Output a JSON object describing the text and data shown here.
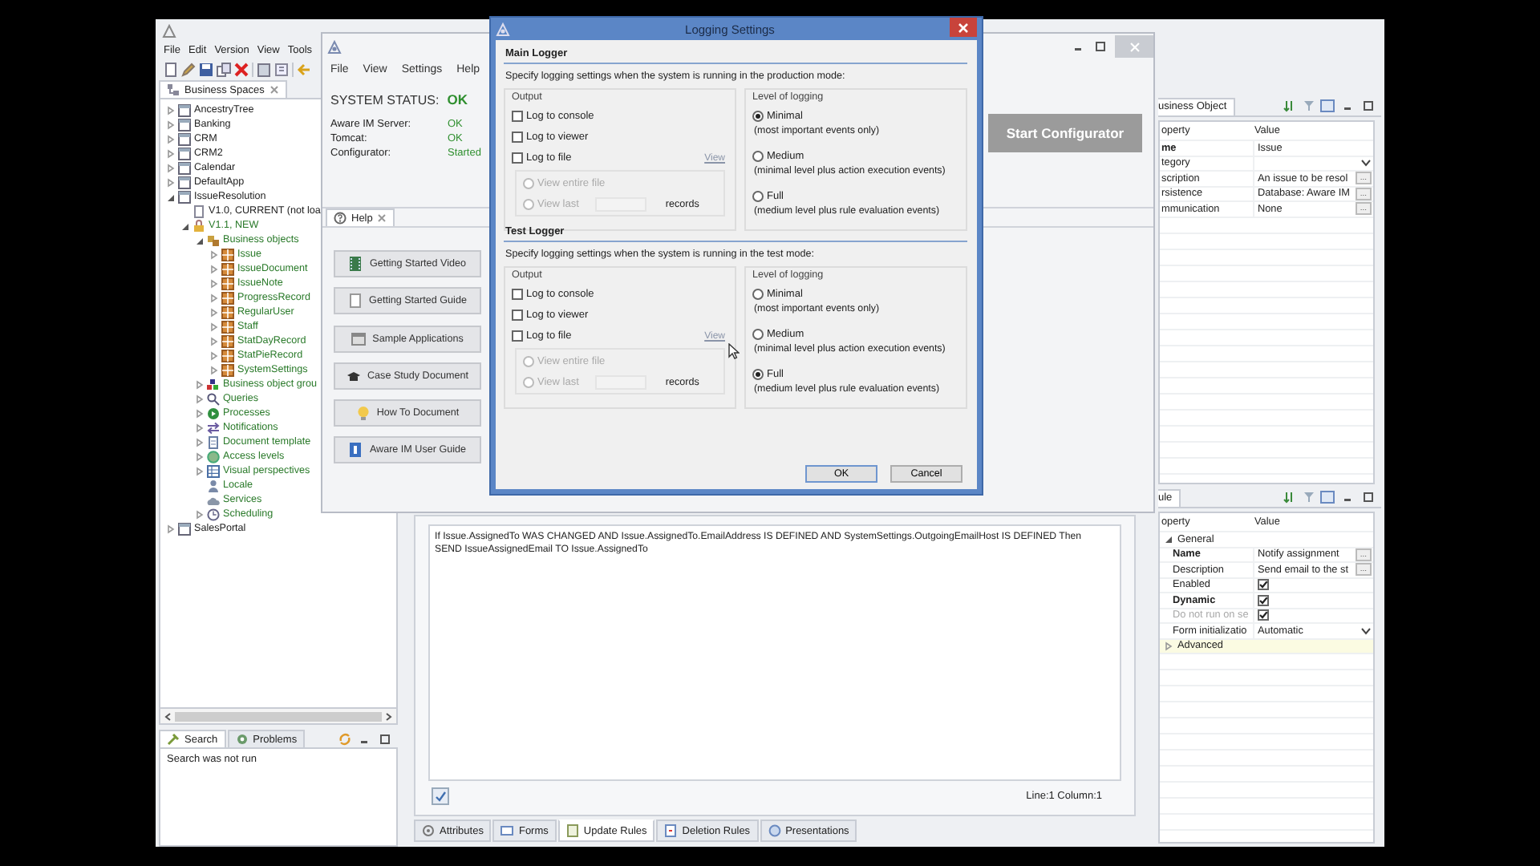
{
  "ide": {
    "menu": [
      "File",
      "Edit",
      "Version",
      "View",
      "Tools"
    ],
    "spaces_panel": {
      "tab": "Business Spaces",
      "tree": [
        {
          "label": "AncestryTree",
          "kind": "space",
          "expanded": false,
          "color": "#222222"
        },
        {
          "label": "Banking",
          "kind": "space",
          "expanded": false,
          "color": "#222222"
        },
        {
          "label": "CRM",
          "kind": "space",
          "expanded": false,
          "color": "#222222"
        },
        {
          "label": "CRM2",
          "kind": "space",
          "expanded": false,
          "color": "#222222"
        },
        {
          "label": "Calendar",
          "kind": "space",
          "expanded": false,
          "color": "#222222"
        },
        {
          "label": "DefaultApp",
          "kind": "space",
          "expanded": false,
          "color": "#222222"
        },
        {
          "label": "IssueResolution",
          "kind": "space",
          "expanded": true,
          "color": "#222222",
          "children": [
            {
              "label": "V1.0, CURRENT (not loa",
              "kind": "version",
              "color": "#222222"
            },
            {
              "label": "V1.1, NEW",
              "kind": "lock",
              "expanded": true,
              "color": "#2a7a2a",
              "children": [
                {
                  "label": "Business objects",
                  "kind": "objects",
                  "expanded": true,
                  "color": "#2a7a2a",
                  "children": [
                    {
                      "label": "Issue",
                      "kind": "object",
                      "expanded": false,
                      "color": "#2a7a2a"
                    },
                    {
                      "label": "IssueDocument",
                      "kind": "object",
                      "expanded": false,
                      "color": "#2a7a2a"
                    },
                    {
                      "label": "IssueNote",
                      "kind": "object",
                      "expanded": false,
                      "color": "#2a7a2a"
                    },
                    {
                      "label": "ProgressRecord",
                      "kind": "object",
                      "expanded": false,
                      "color": "#2a7a2a"
                    },
                    {
                      "label": "RegularUser",
                      "kind": "object",
                      "expanded": false,
                      "color": "#2a7a2a"
                    },
                    {
                      "label": "Staff",
                      "kind": "object",
                      "expanded": false,
                      "color": "#2a7a2a"
                    },
                    {
                      "label": "StatDayRecord",
                      "kind": "object",
                      "expanded": false,
                      "color": "#2a7a2a"
                    },
                    {
                      "label": "StatPieRecord",
                      "kind": "object",
                      "expanded": false,
                      "color": "#2a7a2a"
                    },
                    {
                      "label": "SystemSettings",
                      "kind": "object",
                      "expanded": false,
                      "color": "#2a7a2a"
                    }
                  ]
                },
                {
                  "label": "Business object grou",
                  "kind": "groups",
                  "expanded": false,
                  "color": "#2a7a2a"
                },
                {
                  "label": "Queries",
                  "kind": "query",
                  "expanded": false,
                  "color": "#2a7a2a"
                },
                {
                  "label": "Processes",
                  "kind": "process",
                  "expanded": false,
                  "color": "#2a7a2a"
                },
                {
                  "label": "Notifications",
                  "kind": "notification",
                  "expanded": false,
                  "color": "#2a7a2a"
                },
                {
                  "label": "Document template",
                  "kind": "document",
                  "expanded": false,
                  "color": "#2a7a2a"
                },
                {
                  "label": "Access levels",
                  "kind": "access",
                  "expanded": false,
                  "color": "#2a7a2a"
                },
                {
                  "label": "Visual perspectives",
                  "kind": "perspective",
                  "expanded": false,
                  "color": "#2a7a2a"
                },
                {
                  "label": "Locale",
                  "kind": "locale",
                  "color": "#2a7a2a"
                },
                {
                  "label": "Services",
                  "kind": "services",
                  "color": "#2a7a2a"
                },
                {
                  "label": "Scheduling",
                  "kind": "scheduling",
                  "expanded": false,
                  "color": "#2a7a2a"
                }
              ]
            }
          ]
        },
        {
          "label": "SalesPortal",
          "kind": "space",
          "expanded": false,
          "color": "#222222"
        }
      ]
    },
    "search_panel": {
      "tabs": [
        {
          "label": "Search",
          "selected": true
        },
        {
          "label": "Problems",
          "selected": false
        }
      ],
      "message": "Search was not run"
    },
    "rule_lines": [
      "If Issue.AssignedTo WAS CHANGED  AND Issue.AssignedTo.EmailAddress IS DEFINED AND SystemSettings.OutgoingEmailHost IS DEFINED Then",
      "SEND IssueAssignedEmail TO Issue.AssignedTo"
    ],
    "position": "Line:1 Column:1",
    "editor_tabs": [
      {
        "label": "Attributes",
        "selected": false
      },
      {
        "label": "Forms",
        "selected": false
      },
      {
        "label": "Update Rules",
        "selected": true
      },
      {
        "label": "Deletion Rules",
        "selected": false
      },
      {
        "label": "Presentations",
        "selected": false
      }
    ],
    "object_panel": {
      "tab": "usiness Object",
      "columns": [
        "operty",
        "Value"
      ],
      "rows": [
        {
          "property": "me",
          "bold": true,
          "kind": "text",
          "value": "Issue"
        },
        {
          "property": "tegory",
          "bold": false,
          "kind": "dropdown"
        },
        {
          "property": "scription",
          "bold": false,
          "kind": "text",
          "value": "An issue to be resol",
          "button": "..."
        },
        {
          "property": "rsistence",
          "bold": false,
          "kind": "text",
          "value": "Database: Aware IM",
          "button": "..."
        },
        {
          "property": "mmunication",
          "bold": false,
          "kind": "text",
          "value": "None",
          "button": "..."
        }
      ]
    },
    "rule_panel": {
      "tab": "ule",
      "columns": [
        "operty",
        "Value"
      ],
      "groups": [
        {
          "label": "General",
          "expanded": true,
          "selected": false,
          "rows": [
            {
              "property": "Name",
              "bold": true,
              "disabled": false,
              "kind": "text",
              "value": "Notify assignment",
              "button": "..."
            },
            {
              "property": "Description",
              "bold": false,
              "disabled": false,
              "kind": "text",
              "value": "Send email to the st",
              "button": "..."
            },
            {
              "property": "Enabled",
              "bold": false,
              "disabled": false,
              "kind": "checkbox",
              "checked": true
            },
            {
              "property": "Dynamic",
              "bold": true,
              "disabled": false,
              "kind": "checkbox",
              "checked": true
            },
            {
              "property": "Do not run on se",
              "bold": false,
              "disabled": true,
              "kind": "checkbox",
              "checked": true
            },
            {
              "property": "Form initializatio",
              "bold": false,
              "disabled": false,
              "kind": "dropdown",
              "value": "Automatic"
            }
          ]
        },
        {
          "label": "Advanced",
          "expanded": false,
          "selected": true
        }
      ]
    }
  },
  "control": {
    "menu": [
      "File",
      "View",
      "Settings",
      "Help"
    ],
    "status": {
      "label": "SYSTEM STATUS:",
      "value": "OK"
    },
    "services": [
      {
        "name": "Aware IM Server:",
        "status": "OK"
      },
      {
        "name": "Tomcat:",
        "status": "OK"
      },
      {
        "name": "Configurator:",
        "status": "Started"
      }
    ],
    "start_button": "Start Configurator",
    "help_tab": "Help",
    "help_buttons": [
      {
        "label": "Getting Started Video",
        "kind": "video"
      },
      {
        "label": "Getting Started Guide",
        "kind": "guide"
      },
      {
        "label": "Sample Applications",
        "kind": "samples"
      },
      {
        "label": "Case Study Document",
        "kind": "study"
      },
      {
        "label": "How To Document",
        "kind": "howto"
      },
      {
        "label": "Aware IM User Guide",
        "kind": "book"
      }
    ]
  },
  "dialog": {
    "title": "Logging Settings",
    "loggers": [
      {
        "title": "Main Logger",
        "description": "Specify logging settings when the system is running in the production mode:",
        "output": {
          "label": "Output",
          "options": [
            {
              "label": "Log to console",
              "checked": false
            },
            {
              "label": "Log to viewer",
              "checked": false
            },
            {
              "label": "Log to file",
              "checked": false
            }
          ],
          "link": "View",
          "file_options": [
            {
              "label": "View entire file",
              "selected": false,
              "disabled": true
            },
            {
              "label": "View last",
              "selected": false,
              "disabled": true
            }
          ],
          "records": "records"
        },
        "level": {
          "label": "Level of logging",
          "options": [
            {
              "label": "Minimal",
              "note": "(most important events only)",
              "selected": true
            },
            {
              "label": "Medium",
              "note": "(minimal level plus action execution events)",
              "selected": false
            },
            {
              "label": "Full",
              "note": "(medium level plus rule evaluation events)",
              "selected": false
            }
          ]
        }
      },
      {
        "title": "Test Logger",
        "description": "Specify logging settings when the system is running in the test mode:",
        "output": {
          "label": "Output",
          "options": [
            {
              "label": "Log to console",
              "checked": false
            },
            {
              "label": "Log to viewer",
              "checked": false
            },
            {
              "label": "Log to file",
              "checked": false
            }
          ],
          "link": "View",
          "file_options": [
            {
              "label": "View entire file",
              "selected": false,
              "disabled": true
            },
            {
              "label": "View last",
              "selected": false,
              "disabled": true
            }
          ],
          "records": "records"
        },
        "level": {
          "label": "Level of logging",
          "options": [
            {
              "label": "Minimal",
              "note": "(most important events only)",
              "selected": false
            },
            {
              "label": "Medium",
              "note": "(minimal level plus action execution events)",
              "selected": false
            },
            {
              "label": "Full",
              "note": "(medium level plus rule evaluation events)",
              "selected": true
            }
          ]
        }
      }
    ],
    "buttons": [
      "OK",
      "Cancel"
    ]
  }
}
